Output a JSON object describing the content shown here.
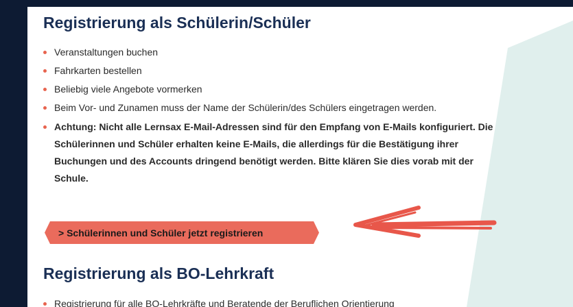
{
  "section1": {
    "title": "Registrierung als Schülerin/Schüler",
    "items": [
      "Veranstaltungen buchen",
      "Fahrkarten bestellen",
      "Beliebig viele Angebote vormerken",
      "Beim Vor- und Zunamen muss der Name der Schülerin/des Schülers eingetragen werden.",
      "Achtung: Nicht alle Lernsax E-Mail-Adressen sind für den Empfang von E-Mails konfiguriert. Die Schülerinnen und Schüler erhalten keine E-Mails, die allerdings für die Bestätigung ihrer Buchungen und des Accounts dringend benötigt werden. Bitte klären Sie dies vorab mit der Schule."
    ],
    "cta_label": "> Schülerinnen und Schüler jetzt registrieren"
  },
  "section2": {
    "title": "Registrierung als BO-Lehrkraft",
    "items": [
      "Registrierung für alle BO-Lehrkräfte und Beratende der Beruflichen Orientierung"
    ]
  },
  "colors": {
    "frame": "#0d1b33",
    "heading": "#1a2f55",
    "accent": "#ea6b5c",
    "decor": "#e0efed"
  },
  "icons": {
    "cta_arrow": "red-hand-drawn-arrow-icon",
    "bullet": "orange-dot-icon"
  }
}
